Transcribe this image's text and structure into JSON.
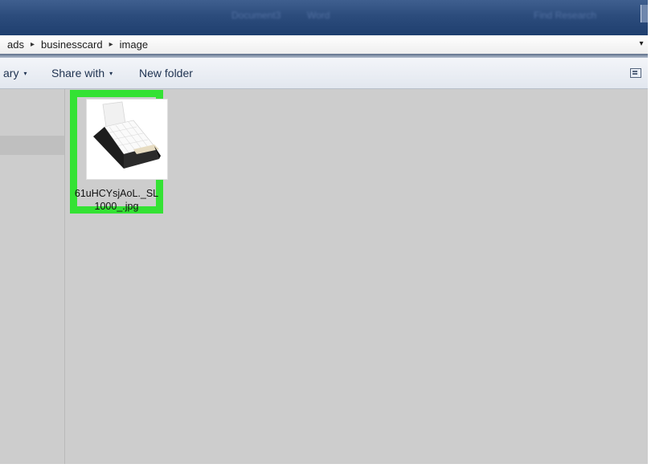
{
  "titlebar": {
    "fragments": [
      "Document3",
      "Word",
      "Find Research"
    ]
  },
  "address": {
    "crumbs": [
      "ads",
      "businesscard",
      "image"
    ],
    "separator": "▸",
    "dropdown_glyph": "▾"
  },
  "toolbar": {
    "library_label": "ary",
    "share_label": "Share with",
    "newfolder_label": "New folder",
    "caret": "▾"
  },
  "files": [
    {
      "name_line1": "61uHCYsjAoL._SL",
      "name_line2": "1000_.jpg",
      "selected": true,
      "highlight_color": "#34e234"
    }
  ],
  "colors": {
    "titlebar": "#2c4c7c",
    "pane_bg": "#cdcdcd",
    "highlight": "#34e234"
  }
}
